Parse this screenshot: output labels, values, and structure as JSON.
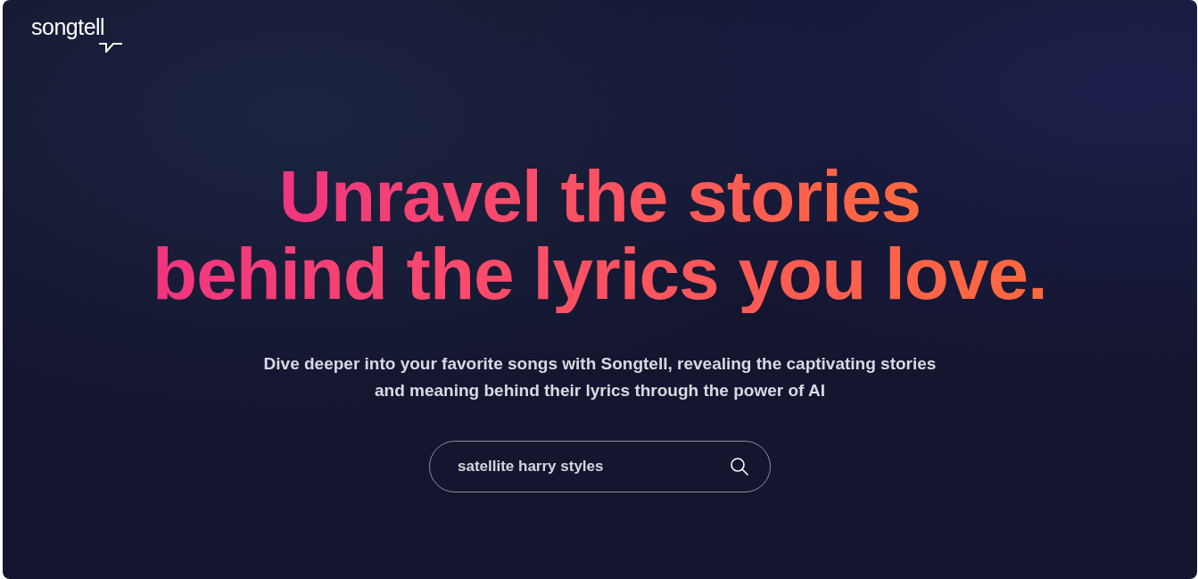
{
  "logo": {
    "text": "songtell"
  },
  "hero": {
    "headline_lines": [
      "Unravel the stories",
      "behind the lyrics you love."
    ],
    "description": "Dive deeper into your favorite songs with Songtell, revealing the captivating stories and meaning behind their lyrics through the power of AI"
  },
  "search": {
    "value": "satellite harry styles"
  }
}
